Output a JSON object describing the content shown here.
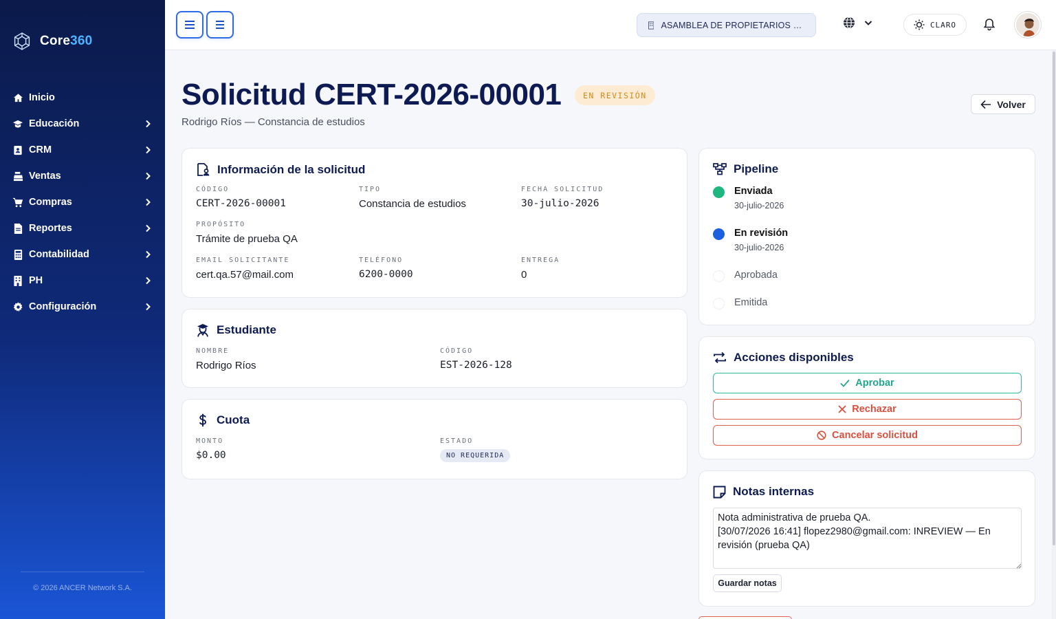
{
  "app": {
    "brand_prefix": "Core",
    "brand_accent": "360",
    "copyright": "© 2026 ANCER Network S.A."
  },
  "sidebar": {
    "items": [
      {
        "label": "Inicio",
        "icon": "home-icon",
        "has_children": false
      },
      {
        "label": "Educación",
        "icon": "graduation-cap-icon",
        "has_children": true
      },
      {
        "label": "CRM",
        "icon": "address-book-icon",
        "has_children": true
      },
      {
        "label": "Ventas",
        "icon": "cash-register-icon",
        "has_children": true
      },
      {
        "label": "Compras",
        "icon": "cart-icon",
        "has_children": true
      },
      {
        "label": "Reportes",
        "icon": "report-file-icon",
        "has_children": true
      },
      {
        "label": "Contabilidad",
        "icon": "calculator-icon",
        "has_children": true
      },
      {
        "label": "PH",
        "icon": "building-icon",
        "has_children": true
      },
      {
        "label": "Configuración",
        "icon": "gear-icon",
        "has_children": true
      }
    ]
  },
  "topbar": {
    "organization": "ASAMBLEA DE PROPIETARIOS DE ...",
    "theme_label": "CLARO"
  },
  "page": {
    "title": "Solicitud CERT-2026-00001",
    "status": "EN REVISIÓN",
    "subtitle": "Rodrigo Ríos — Constancia de estudios",
    "back_label": "Volver"
  },
  "info_card": {
    "title": "Información de la solicitud",
    "codigo_label": "CÓDIGO",
    "codigo": "CERT-2026-00001",
    "tipo_label": "TIPO",
    "tipo": "Constancia de estudios",
    "fecha_label": "FECHA SOLICITUD",
    "fecha": "30-julio-2026",
    "proposito_label": "PROPÓSITO",
    "proposito": "Trámite de prueba QA",
    "email_label": "EMAIL SOLICITANTE",
    "email": "cert.qa.57@mail.com",
    "telefono_label": "TELÉFONO",
    "telefono": "6200-0000",
    "entrega_label": "ENTREGA",
    "entrega": "0"
  },
  "student_card": {
    "title": "Estudiante",
    "nombre_label": "NOMBRE",
    "nombre": "Rodrigo Ríos",
    "codigo_label": "CÓDIGO",
    "codigo": "EST-2026-128"
  },
  "fee_card": {
    "title": "Cuota",
    "monto_label": "MONTO",
    "monto": "$0.00",
    "estado_label": "ESTADO",
    "estado": "NO REQUERIDA"
  },
  "pipeline": {
    "title": "Pipeline",
    "steps": [
      {
        "name": "Enviada",
        "date": "30-julio-2026",
        "state": "done"
      },
      {
        "name": "En revisión",
        "date": "30-julio-2026",
        "state": "current"
      },
      {
        "name": "Aprobada",
        "date": "",
        "state": "pending"
      },
      {
        "name": "Emitida",
        "date": "",
        "state": "pending"
      }
    ]
  },
  "actions": {
    "title": "Acciones disponibles",
    "approve": "Aprobar",
    "reject": "Rechazar",
    "cancel": "Cancelar solicitud"
  },
  "notes": {
    "title": "Notas internas",
    "content": "Nota administrativa de prueba QA.\n[30/07/2026 16:41] flopez2980@gmail.com: INREVIEW — En revisión (prueba QA)",
    "save_label": "Guardar notas"
  },
  "colors": {
    "navy": "#0d1b52",
    "accent_blue": "#2d6ae8",
    "status_done": "#1db77f",
    "status_current": "#1e5fe0",
    "warning_bg": "#fdebd3",
    "warning_text": "#d38a1c",
    "approve": "#22a58f",
    "danger": "#d9503e"
  }
}
